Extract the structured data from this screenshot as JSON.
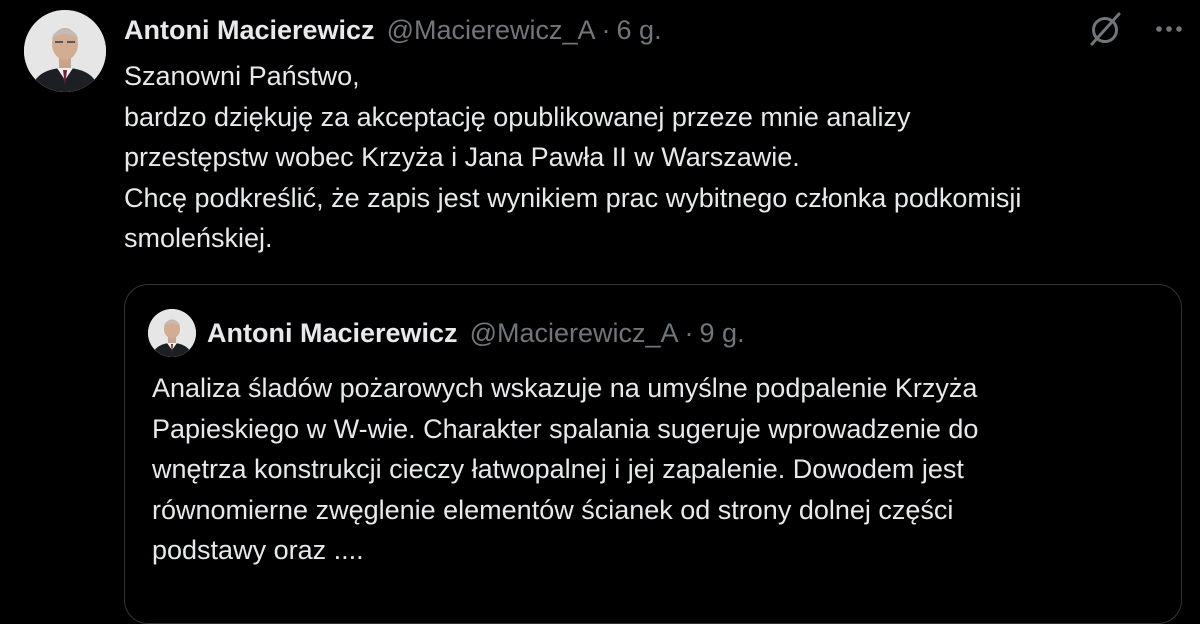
{
  "colors": {
    "background": "#000000",
    "text_primary": "#e7e9ea",
    "text_secondary": "#71767b",
    "border": "#2f3336"
  },
  "tweet": {
    "author_name": "Antoni Macierewicz",
    "handle": "@Macierewicz_A",
    "separator": "·",
    "time": "6 g.",
    "icons": [
      "grok-icon",
      "more-icon"
    ],
    "text_lines": [
      "Szanowni Państwo,",
      "bardzo dziękuję za akceptację opublikowanej przeze mnie analizy",
      "przestępstw wobec Krzyża i Jana Pawła II w Warszawie.",
      "Chcę podkreślić, że zapis jest wynikiem prac wybitnego członka podkomisji",
      "smoleńskiej."
    ]
  },
  "quoted_tweet": {
    "author_name": "Antoni Macierewicz",
    "handle": "@Macierewicz_A",
    "separator": "·",
    "time": "9 g.",
    "text_lines": [
      "Analiza śladów pożarowych wskazuje na umyślne podpalenie Krzyża",
      "Papieskiego w W-wie. Charakter spalania sugeruje wprowadzenie do",
      "wnętrza konstrukcji cieczy łatwopalnej i jej zapalenie. Dowodem jest",
      "równomierne zwęglenie elementów ścianek od strony dolnej części",
      "podstawy oraz ...."
    ]
  }
}
